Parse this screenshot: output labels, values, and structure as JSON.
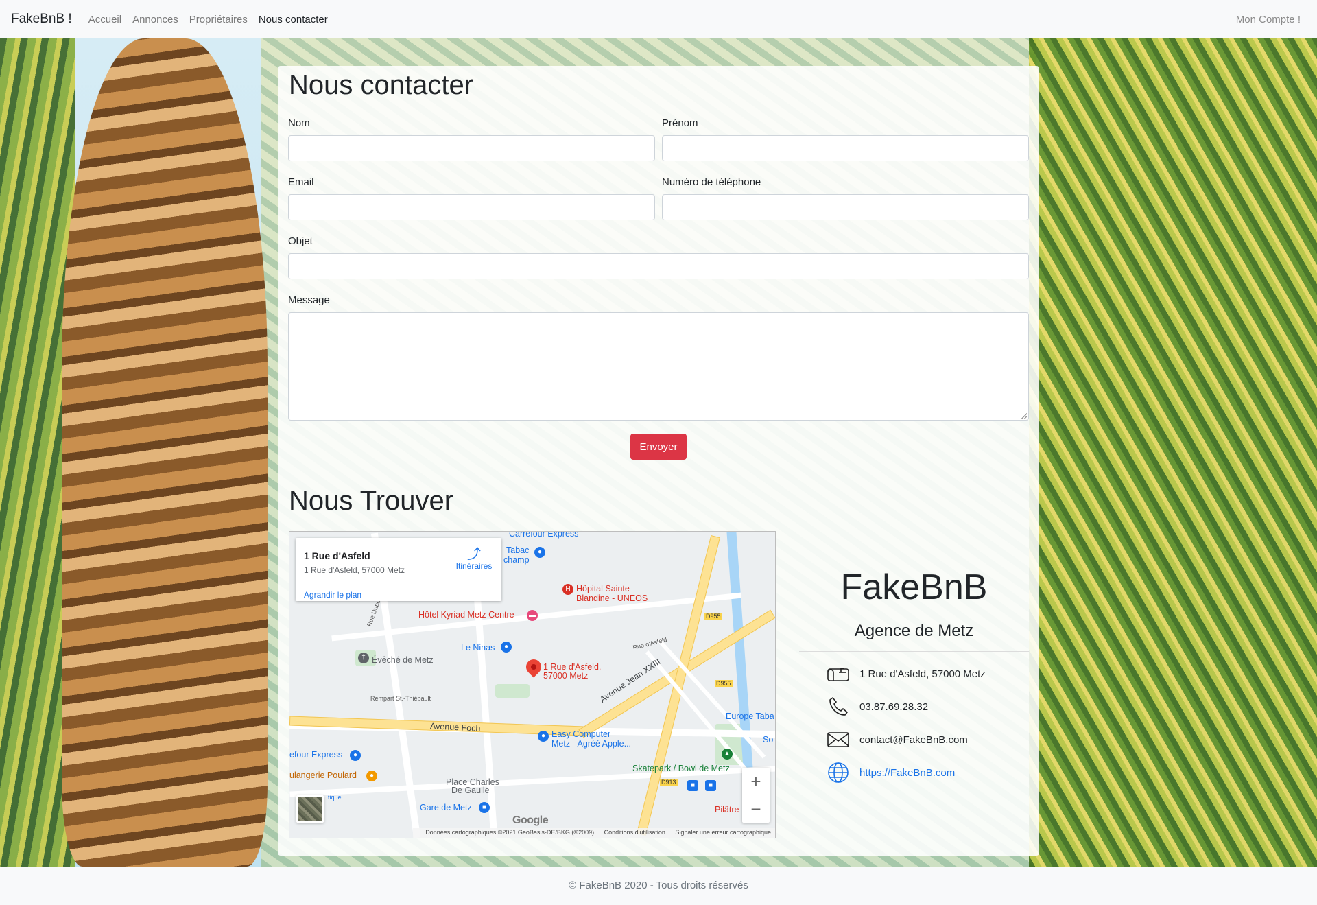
{
  "navbar": {
    "brand": "FakeBnB !",
    "links": [
      "Accueil",
      "Annonces",
      "Propriétaires",
      "Nous contacter"
    ],
    "account": "Mon Compte !"
  },
  "contact": {
    "title": "Nous contacter",
    "fields": {
      "nom": {
        "label": "Nom",
        "value": ""
      },
      "prenom": {
        "label": "Prénom",
        "value": ""
      },
      "email": {
        "label": "Email",
        "value": ""
      },
      "telephone": {
        "label": "Numéro de téléphone",
        "value": ""
      },
      "objet": {
        "label": "Objet",
        "value": ""
      },
      "message": {
        "label": "Message",
        "value": ""
      }
    },
    "submit": "Envoyer",
    "colors": {
      "submit": "#dc3545"
    }
  },
  "find": {
    "title": "Nous Trouver",
    "map": {
      "info_title": "1 Rue d'Asfeld",
      "info_address": "1 Rue d'Asfeld, 57000 Metz",
      "enlarge": "Agrandir le plan",
      "directions": "Itinéraires",
      "marker_label_1": "1 Rue d'Asfeld,",
      "marker_label_2": "57000 Metz",
      "pois": {
        "carrefour": "Carrefour Express",
        "tabac1": "Tabac",
        "tabac2": "champ",
        "hopital1": "Hôpital Sainte",
        "hopital2": "Blandine - UNEOS",
        "hotel": "Hôtel Kyriad Metz Centre",
        "lesninas": "Le Ninas",
        "eveche": "Évêché de Metz",
        "easy1": "Easy Computer",
        "easy2": "Metz - Agréé Apple...",
        "europe": "Europe Taba",
        "carrefour2": "efour Express",
        "boulangerie": "ulangerie Poulard",
        "skatepark": "Skatepark / Bowl de Metz",
        "place1": "Place Charles",
        "place2": "De Gaulle",
        "gare": "Gare de Metz",
        "pilatre": "Pilâtre",
        "avfoch": "Avenue Foch",
        "avjean": "Avenue Jean XXIII",
        "rempart": "Rempart St.-Thiébault",
        "ruedasfeld": "Rue d'Asfeld",
        "ruedupont": "Rue Dupont",
        "d955a": "D955",
        "d955b": "D955",
        "d913": "D913",
        "tique": "tique",
        "so": "So"
      },
      "google": "Google",
      "zoom_in": "+",
      "zoom_out": "−",
      "footer": {
        "data": "Données cartographiques ©2021 GeoBasis-DE/BKG (©2009)",
        "terms": "Conditions d'utilisation",
        "report": "Signaler une erreur cartographique"
      }
    },
    "agency": {
      "name": "FakeBnB",
      "subtitle": "Agence de Metz",
      "address": "1 Rue d'Asfeld, 57000 Metz",
      "phone": "03.87.69.28.32",
      "email": "contact@FakeBnB.com",
      "website": "https://FakeBnB.com"
    },
    "icons": [
      "mailbox-icon",
      "phone-icon",
      "envelope-icon",
      "globe-icon"
    ]
  },
  "footer": {
    "text": "© FakeBnB 2020 - Tous droits réservés"
  }
}
